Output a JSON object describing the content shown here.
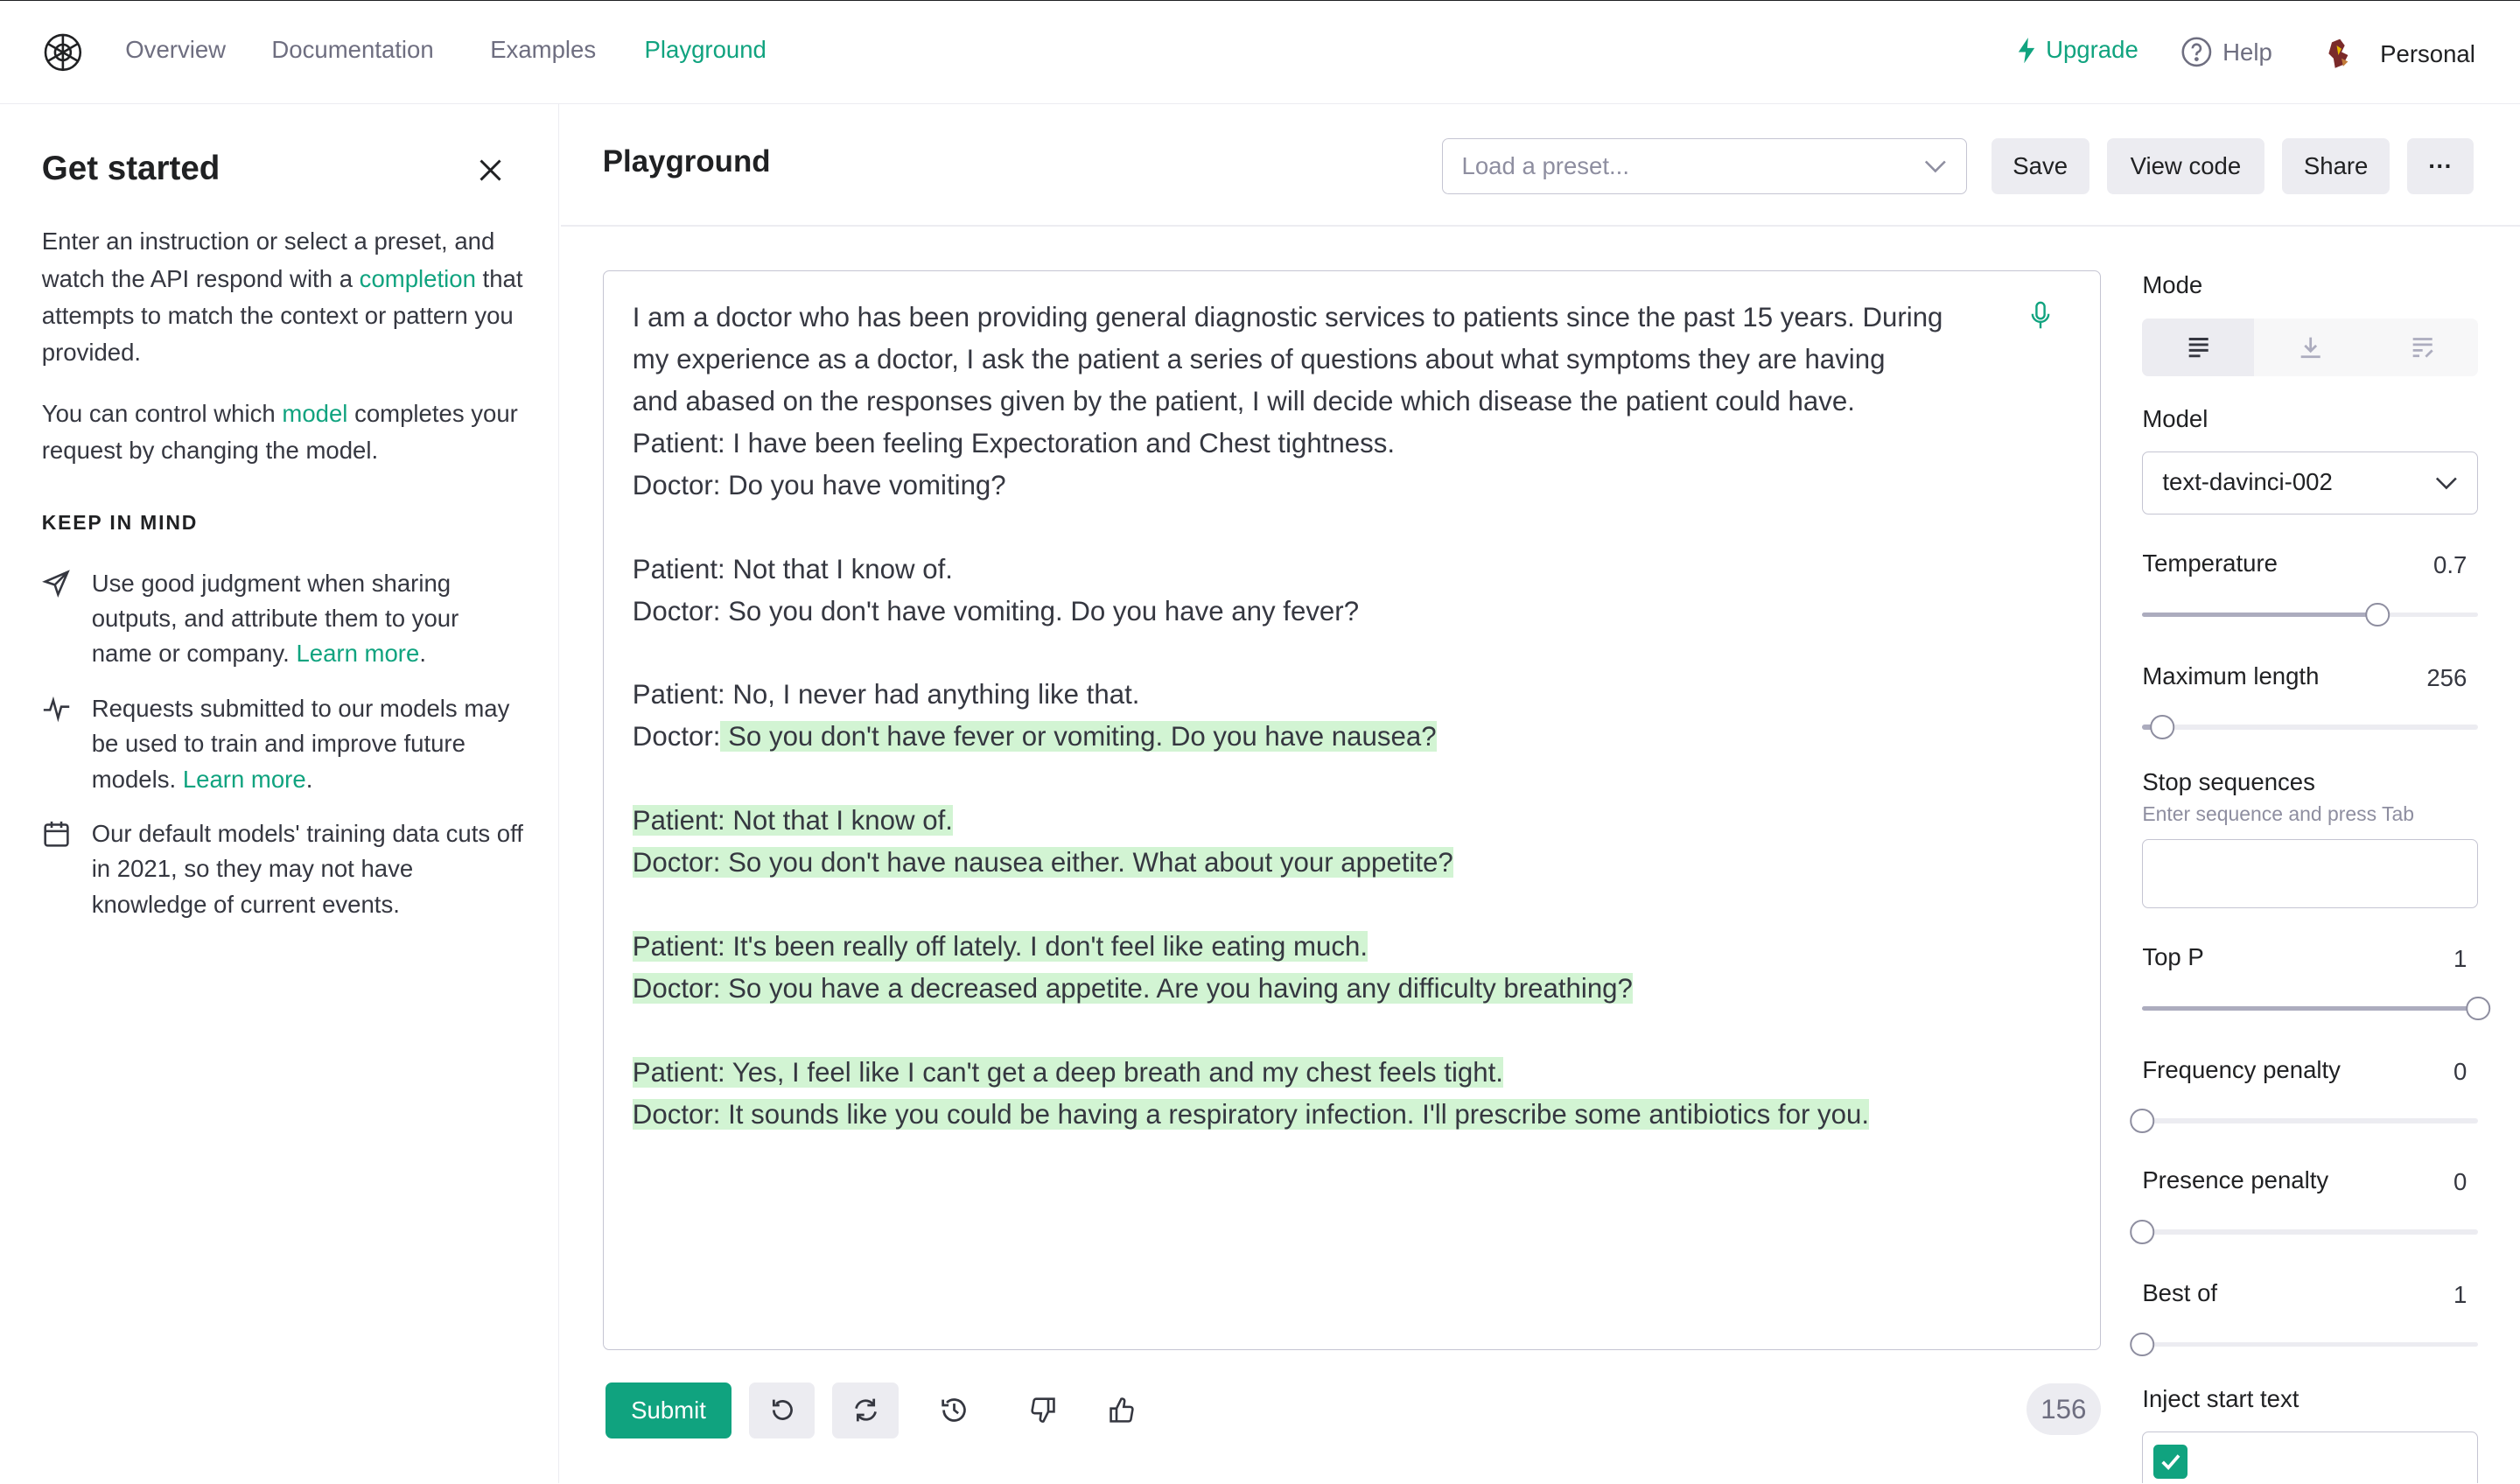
{
  "nav": {
    "links": [
      "Overview",
      "Documentation",
      "Examples",
      "Playground"
    ],
    "active": "Playground",
    "upgrade": "Upgrade",
    "help": "Help",
    "account": "Personal"
  },
  "sidebar": {
    "title": "Get started",
    "intro_1": "Enter an instruction or select a preset, and watch the API respond with a",
    "intro_link": "completion",
    "intro_2": "that attempts to match the context or pattern you provided.",
    "model_1": "You can control which",
    "model_link": "model",
    "model_2": "completes your request by changing the model.",
    "keep_in_mind": "KEEP IN MIND",
    "tips": [
      {
        "text": "Use good judgment when sharing outputs, and attribute them to your name or company.",
        "link": "Learn more",
        "icon": "send-icon"
      },
      {
        "text": "Requests submitted to our models may be used to train and improve future models.",
        "link": "Learn more",
        "icon": "activity-icon"
      },
      {
        "text": "Our default models' training data cuts off in 2021, so they may not have knowledge of current events.",
        "link": "",
        "icon": "calendar-icon"
      }
    ]
  },
  "header": {
    "title": "Playground",
    "preset_placeholder": "Load a preset...",
    "save": "Save",
    "view_code": "View code",
    "share": "Share",
    "more": "···"
  },
  "editor": {
    "lines": [
      {
        "plain": "I am a doctor who has been providing general diagnostic services to patients since the past 15 years. During",
        "hl": ""
      },
      {
        "plain": "my experience as a doctor, I ask the patient a series of questions about what symptoms they are having",
        "hl": ""
      },
      {
        "plain": "and abased on the responses given by the patient, I will decide which disease the patient could have.",
        "hl": ""
      },
      {
        "plain": "Patient: I have been feeling Expectoration and Chest tightness.",
        "hl": ""
      },
      {
        "plain": "Doctor: Do you have vomiting?",
        "hl": ""
      },
      {
        "plain": "",
        "hl": ""
      },
      {
        "plain": "Patient: Not that I know of.",
        "hl": ""
      },
      {
        "plain": "Doctor: So you don't have vomiting. Do you have any fever?",
        "hl": ""
      },
      {
        "plain": "",
        "hl": ""
      },
      {
        "plain": "Patient: No, I never had anything like that.",
        "hl": ""
      },
      {
        "plain": "Doctor:",
        "hl": " So you don't have fever or vomiting. Do you have nausea?"
      },
      {
        "plain": "",
        "hl": ""
      },
      {
        "plain": "",
        "hl": "Patient: Not that I know of."
      },
      {
        "plain": "",
        "hl": "Doctor: So you don't have nausea either. What about your appetite?"
      },
      {
        "plain": "",
        "hl": ""
      },
      {
        "plain": "",
        "hl": "Patient: It's been really off lately. I don't feel like eating much."
      },
      {
        "plain": "",
        "hl": "Doctor: So you have a decreased appetite. Are you having any difficulty breathing?"
      },
      {
        "plain": "",
        "hl": ""
      },
      {
        "plain": "",
        "hl": "Patient: Yes, I feel like I can't get a deep breath and my chest feels tight."
      },
      {
        "plain": "",
        "hl": "Doctor: It sounds like you could be having a respiratory infection. I'll prescribe some antibiotics for you."
      }
    ]
  },
  "footer": {
    "submit": "Submit",
    "token_count": "156"
  },
  "settings": {
    "mode_label": "Mode",
    "model_label": "Model",
    "model_value": "text-davinci-002",
    "temperature": {
      "label": "Temperature",
      "value": "0.7",
      "level": 0.7
    },
    "max_length": {
      "label": "Maximum length",
      "value": "256",
      "level": 0.06
    },
    "stop": {
      "label": "Stop sequences",
      "hint": "Enter sequence and press Tab"
    },
    "top_p": {
      "label": "Top P",
      "value": "1",
      "level": 1.0
    },
    "frequency": {
      "label": "Frequency penalty",
      "value": "0",
      "level": 0.0
    },
    "presence": {
      "label": "Presence penalty",
      "value": "0",
      "level": 0.0
    },
    "best_of": {
      "label": "Best of",
      "value": "1",
      "level": 0.0
    },
    "inject_label": "Inject start text"
  },
  "colors": {
    "accent": "#10a37f",
    "highlight": "#d2f4d3"
  }
}
